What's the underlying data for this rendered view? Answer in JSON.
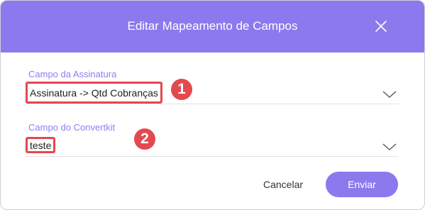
{
  "dialog": {
    "title": "Editar Mapeamento de Campos",
    "header_color": "#8c79ee",
    "close_icon": "close-icon"
  },
  "fields": [
    {
      "label": "Campo da Assinatura",
      "value": "Assinatura -> Qtd Cobranças",
      "annotation": "1",
      "dropdown_icon": "chevron-down-icon"
    },
    {
      "label": "Campo do Convertkit",
      "value": "teste",
      "annotation": "2",
      "dropdown_icon": "chevron-down-icon"
    }
  ],
  "actions": {
    "cancel_label": "Cancelar",
    "submit_label": "Enviar"
  },
  "colors": {
    "accent": "#8c79ee",
    "label": "#8d7ef3",
    "annotation_red": "#e3494f"
  }
}
